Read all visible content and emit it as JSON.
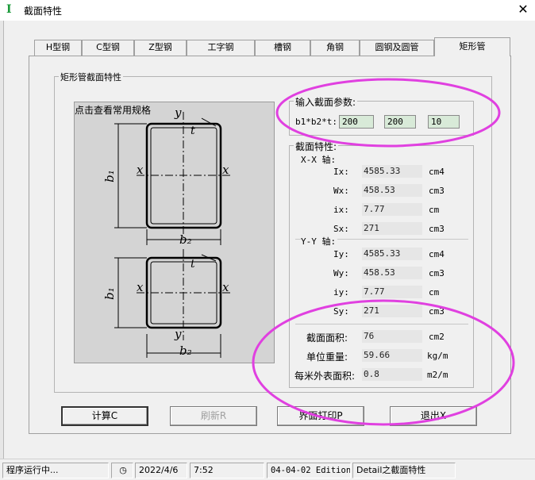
{
  "window": {
    "title": "截面特性",
    "app_icon_glyph": "I",
    "close_glyph": "✕"
  },
  "tabs": [
    {
      "label": "H型钢",
      "active": false
    },
    {
      "label": "C型钢",
      "active": false
    },
    {
      "label": "Z型钢",
      "active": false
    },
    {
      "label": "工字钢",
      "active": false
    },
    {
      "label": "槽钢",
      "active": false
    },
    {
      "label": "角钢",
      "active": false
    },
    {
      "label": "圆钢及圆管",
      "active": false
    },
    {
      "label": "矩形管",
      "active": true
    }
  ],
  "group": {
    "title": "矩形管截面特性"
  },
  "drawing": {
    "hint": "点击查看常用规格",
    "labels": {
      "y": "y",
      "x": "x",
      "t": "t",
      "b1": "b₁",
      "b2": "b₂"
    }
  },
  "input_group": {
    "title": "输入截面参数:",
    "param_label": "b1*b2*t:",
    "b1": "200",
    "b2": "200",
    "t": "10"
  },
  "properties": {
    "title": "截面特性:",
    "xx_axis_label": "X-X 轴:",
    "yy_axis_label": "Y-Y 轴:",
    "xx": [
      {
        "label": "Ix:",
        "value": "4585.33",
        "unit": "cm4"
      },
      {
        "label": "Wx:",
        "value": "458.53",
        "unit": "cm3"
      },
      {
        "label": "ix:",
        "value": "7.77",
        "unit": "cm"
      },
      {
        "label": "Sx:",
        "value": "271",
        "unit": "cm3"
      }
    ],
    "yy": [
      {
        "label": "Iy:",
        "value": "4585.33",
        "unit": "cm4"
      },
      {
        "label": "Wy:",
        "value": "458.53",
        "unit": "cm3"
      },
      {
        "label": "iy:",
        "value": "7.77",
        "unit": "cm"
      },
      {
        "label": "Sy:",
        "value": "271",
        "unit": "cm3"
      }
    ],
    "summary": [
      {
        "label": "截面面积:",
        "value": "76",
        "unit": "cm2"
      },
      {
        "label": "单位重量:",
        "value": "59.66",
        "unit": "kg/m"
      },
      {
        "label": "每米外表面积:",
        "value": "0.8",
        "unit": "m2/m"
      }
    ]
  },
  "buttons": {
    "calculate": "计算C",
    "refresh": "刷新R",
    "print": "界面打印P",
    "exit": "退出X"
  },
  "statusbar": {
    "status": "程序运行中...",
    "date": "2022/4/6",
    "time": "7:52",
    "edition": "04-04-02 Edition",
    "context": "Detail之截面特性"
  },
  "colors": {
    "annotation_ellipse": "#e040e0",
    "input_bg": "#d8ead8",
    "app_icon": "#1a9a3a"
  }
}
